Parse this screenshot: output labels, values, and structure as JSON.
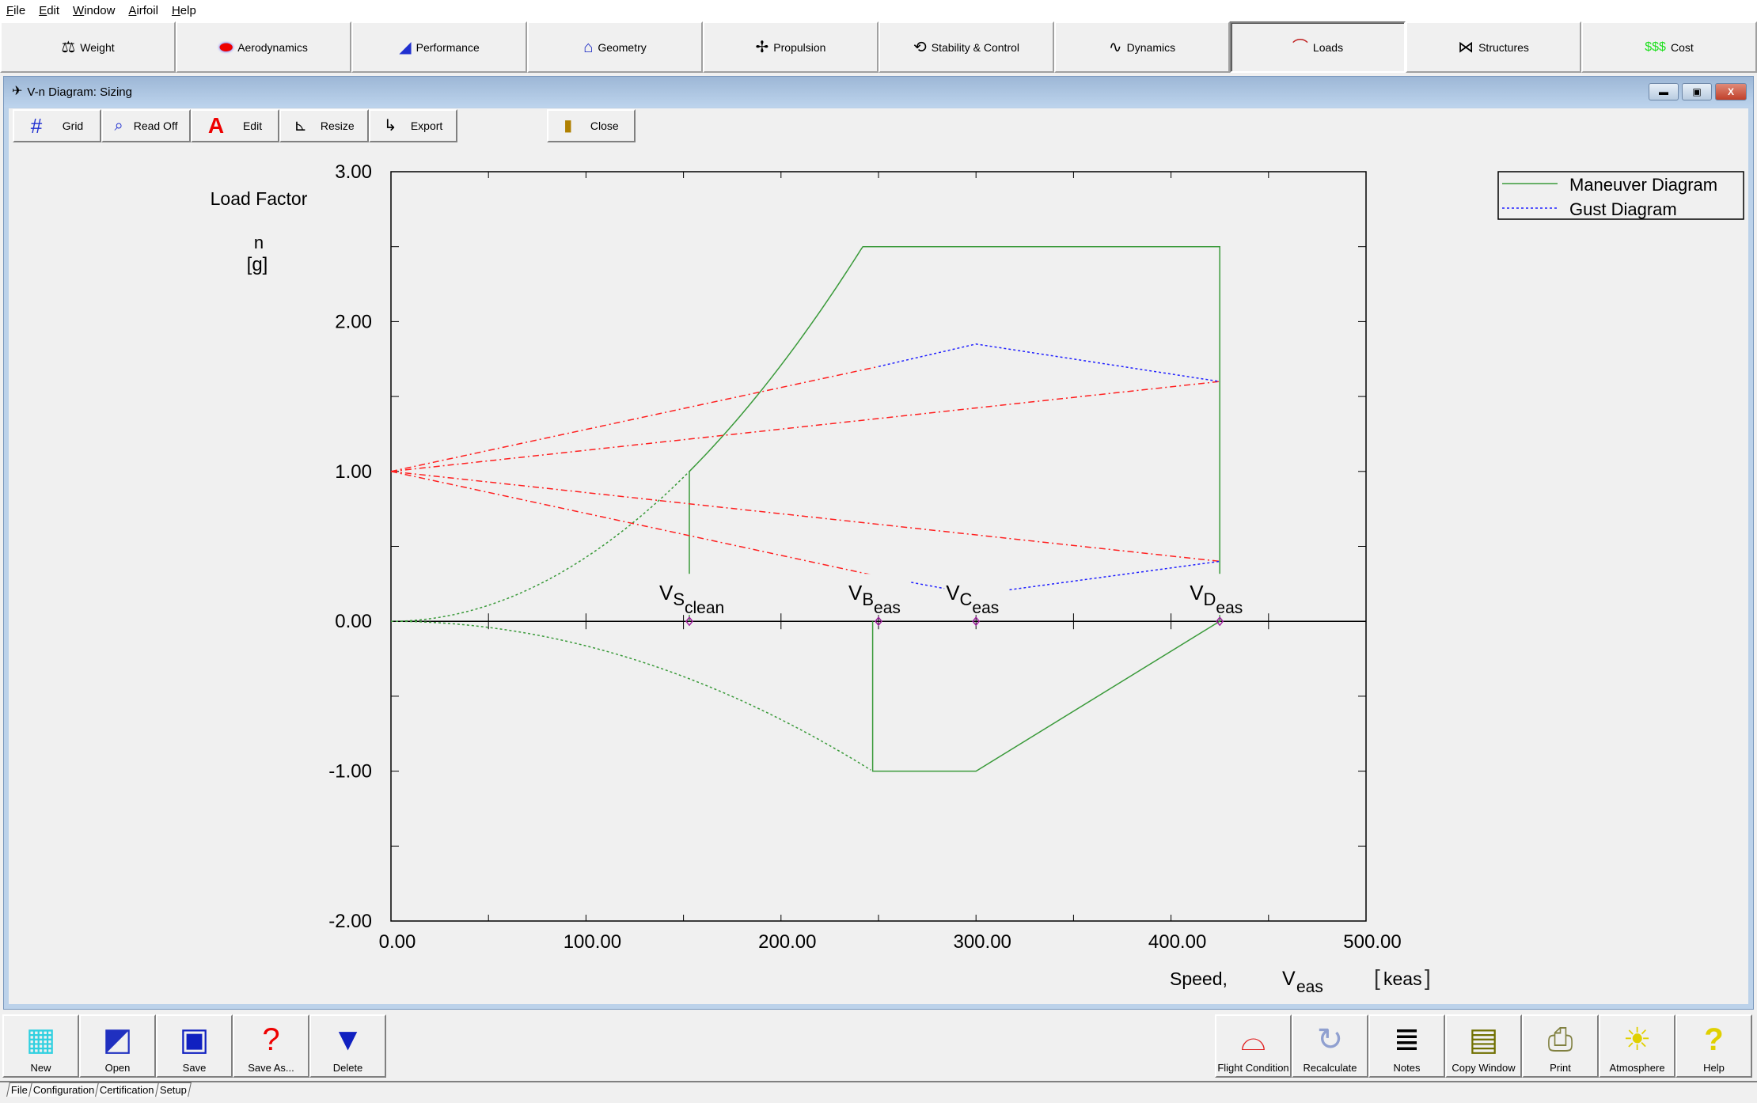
{
  "menu": [
    "File",
    "Edit",
    "Window",
    "Airfoil",
    "Help"
  ],
  "modules": [
    {
      "label": "Weight",
      "icon": "scale-icon"
    },
    {
      "label": "Aerodynamics",
      "icon": "airflow-icon"
    },
    {
      "label": "Performance",
      "icon": "performance-icon"
    },
    {
      "label": "Geometry",
      "icon": "wing-icon"
    },
    {
      "label": "Propulsion",
      "icon": "propeller-icon"
    },
    {
      "label": "Stability & Control",
      "icon": "stability-icon"
    },
    {
      "label": "Dynamics",
      "icon": "dynamics-icon"
    },
    {
      "label": "Loads",
      "icon": "loads-icon",
      "active": true
    },
    {
      "label": "Structures",
      "icon": "truss-icon"
    },
    {
      "label": "Cost",
      "icon": "dollar-icon",
      "icon_text": "$$$"
    }
  ],
  "window": {
    "title": "V-n Diagram: Sizing"
  },
  "toolbar": {
    "grid": "Grid",
    "read_off": "Read Off",
    "edit": "Edit",
    "resize": "Resize",
    "export": "Export",
    "close": "Close"
  },
  "chart_data": {
    "type": "line",
    "ylabel": "Load Factor",
    "ylabel_symbol": "n",
    "ylabel_unit": "[g]",
    "xlabel": "Speed,",
    "xlabel_symbol": "V",
    "xlabel_sub": "eas",
    "xlabel_unit": "keas",
    "xlim": [
      0,
      500
    ],
    "ylim": [
      -2,
      3
    ],
    "xticks": [
      "0.00",
      "100.00",
      "200.00",
      "300.00",
      "400.00",
      "500.00"
    ],
    "yticks": [
      "3.00",
      "2.00",
      "1.00",
      "0.00",
      "-1.00",
      "-2.00"
    ],
    "legend_position": "top-right",
    "legend": [
      {
        "name": "Maneuver Diagram",
        "color": "#3a9a3a"
      },
      {
        "name": "Gust Diagram",
        "color": "#2020ff"
      }
    ],
    "speeds": {
      "vs_clean": 153,
      "vb": 250,
      "vc": 300,
      "vd": 425,
      "vs_negative": 247
    },
    "n_max": 2.5,
    "n_min": -1,
    "maneuver_solid": [
      [
        153,
        1
      ],
      [
        242,
        2.5
      ],
      [
        425,
        2.5
      ],
      [
        425,
        0
      ],
      [
        300,
        -1
      ],
      [
        247,
        -1
      ],
      [
        247,
        0
      ]
    ],
    "stall_line": [
      [
        153,
        1
      ],
      [
        153,
        0
      ]
    ],
    "gust_upper": [
      [
        250,
        1.7
      ],
      [
        300,
        1.85
      ],
      [
        425,
        1.6
      ]
    ],
    "gust_lower": [
      [
        250,
        0.3
      ],
      [
        300,
        0.18
      ],
      [
        425,
        0.4
      ]
    ],
    "gust_rays": [
      [
        [
          0,
          1
        ],
        [
          250,
          1.7
        ]
      ],
      [
        [
          0,
          1
        ],
        [
          425,
          1.6
        ]
      ],
      [
        [
          0,
          1
        ],
        [
          250,
          0.3
        ]
      ],
      [
        [
          0,
          1
        ],
        [
          425,
          0.4
        ]
      ]
    ],
    "speed_labels": [
      {
        "v": "V",
        "sub": "S",
        "subsub": "clean",
        "x": 153
      },
      {
        "v": "V",
        "sub": "B",
        "subsub": "eas",
        "x": 250
      },
      {
        "v": "V",
        "sub": "C",
        "subsub": "eas",
        "x": 300
      },
      {
        "v": "V",
        "sub": "D",
        "subsub": "eas",
        "x": 425
      }
    ]
  },
  "bottom_left": [
    "New",
    "Open",
    "Save",
    "Save As...",
    "Delete"
  ],
  "bottom_right": [
    "Flight Condition",
    "Recalculate",
    "Notes",
    "Copy Window",
    "Print",
    "Atmosphere",
    "Help"
  ],
  "tabs": [
    "File",
    "Configuration",
    "Certification",
    "Setup"
  ]
}
